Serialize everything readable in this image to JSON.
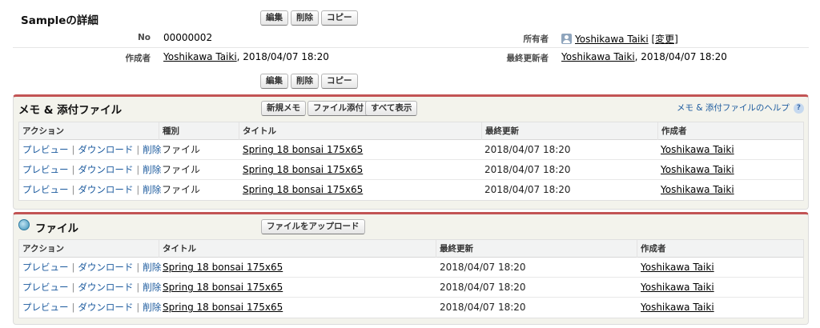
{
  "detail": {
    "title": "Sampleの詳細",
    "buttons": {
      "edit": "編集",
      "delete": "削除",
      "copy": "コピー"
    },
    "no_label": "No",
    "no_value": "00000002",
    "owner_label": "所有者",
    "owner_name": "Yoshikawa Taiki",
    "owner_change": "[変更]",
    "created_by_label": "作成者",
    "created_by_name": "Yoshikawa Taiki",
    "created_by_date": ", 2018/04/07 18:20",
    "modified_by_label": "最終更新者",
    "modified_by_name": "Yoshikawa Taiki",
    "modified_by_date": ", 2018/04/07 18:20"
  },
  "notes": {
    "title": "メモ & 添付ファイル",
    "buttons": {
      "new_note": "新規メモ",
      "attach": "ファイル添付",
      "show_all": "すべて表示"
    },
    "help": "メモ & 添付ファイルのヘルプ",
    "help_icon": "?",
    "columns": {
      "action": "アクション",
      "type": "種別",
      "title": "タイトル",
      "modified": "最終更新",
      "author": "作成者"
    },
    "rows": [
      {
        "preview": "プレビュー",
        "download": "ダウンロード",
        "delete": "削除",
        "type": "ファイル",
        "title": "Spring 18 bonsai 175x65",
        "modified": "2018/04/07 18:20",
        "author": "Yoshikawa Taiki"
      },
      {
        "preview": "プレビュー",
        "download": "ダウンロード",
        "delete": "削除",
        "type": "ファイル",
        "title": "Spring 18 bonsai 175x65",
        "modified": "2018/04/07 18:20",
        "author": "Yoshikawa Taiki"
      },
      {
        "preview": "プレビュー",
        "download": "ダウンロード",
        "delete": "削除",
        "type": "ファイル",
        "title": "Spring 18 bonsai 175x65",
        "modified": "2018/04/07 18:20",
        "author": "Yoshikawa Taiki"
      }
    ]
  },
  "files": {
    "title": "ファイル",
    "buttons": {
      "upload": "ファイルをアップロード"
    },
    "columns": {
      "action": "アクション",
      "title": "タイトル",
      "modified": "最終更新",
      "author": "作成者"
    },
    "rows": [
      {
        "preview": "プレビュー",
        "download": "ダウンロード",
        "delete": "削除",
        "title": "Spring 18 bonsai 175x65",
        "modified": "2018/04/07 18:20",
        "author": "Yoshikawa Taiki"
      },
      {
        "preview": "プレビュー",
        "download": "ダウンロード",
        "delete": "削除",
        "title": "Spring 18 bonsai 175x65",
        "modified": "2018/04/07 18:20",
        "author": "Yoshikawa Taiki"
      },
      {
        "preview": "プレビュー",
        "download": "ダウンロード",
        "delete": "削除",
        "title": "Spring 18 bonsai 175x65",
        "modified": "2018/04/07 18:20",
        "author": "Yoshikawa Taiki"
      }
    ]
  },
  "colors": {
    "accent": "#c25454",
    "link": "#1b5a9e"
  }
}
